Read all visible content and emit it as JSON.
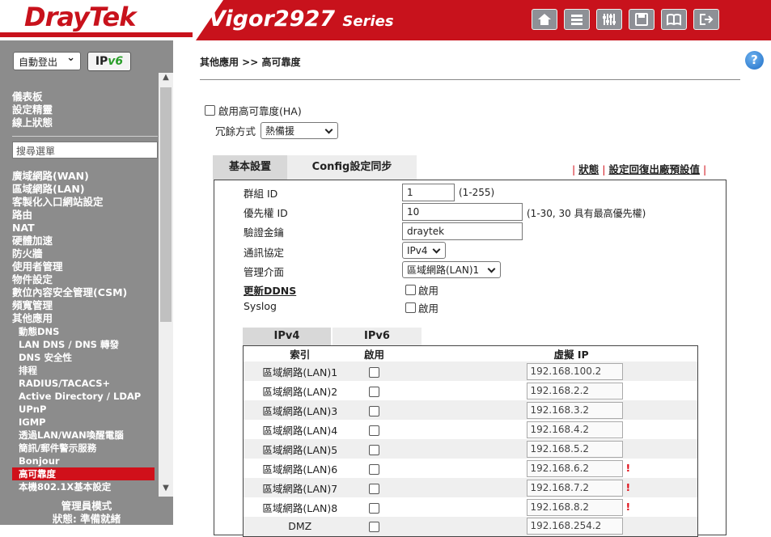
{
  "header": {
    "brand": "DrayTek",
    "model": "Vigor2927",
    "model_suffix": "Series",
    "icons": [
      "home-icon",
      "menu-icon",
      "settings-sliders-icon",
      "save-icon",
      "manual-book-icon",
      "logout-icon"
    ]
  },
  "sidebar": {
    "auto_logout": "自動登出",
    "ipv6_label_a": "IP",
    "ipv6_label_b": "v6",
    "group1": [
      "儀表板",
      "設定精靈",
      "線上狀態"
    ],
    "search_placeholder": "搜尋選單",
    "group2": [
      "廣域網路(WAN)",
      "區域網路(LAN)",
      "客製化入口網站設定",
      "路由",
      "NAT",
      "硬體加速",
      "防火牆",
      "使用者管理",
      "物件設定",
      "數位內容安全管理(CSM)",
      "頻寬管理",
      "其他應用"
    ],
    "sub_items": [
      "動態DNS",
      "LAN DNS / DNS 轉發",
      "DNS 安全性",
      "排程",
      "RADIUS/TACACS+",
      "Active Directory / LDAP",
      "UPnP",
      "IGMP",
      "透過LAN/WAN喚醒電腦",
      "簡訊/郵件警示服務",
      "Bonjour",
      "高可靠度",
      "本機802.1X基本設定"
    ],
    "active_sub": "高可靠度",
    "footer_line1": "管理員模式",
    "footer_line2": "狀態: 準備就緒"
  },
  "main": {
    "breadcrumb": "其他應用 >> 高可靠度",
    "ha_enable_label": "啟用高可靠度(HA)",
    "redundancy_label": "冗餘方式",
    "redundancy_value": "熱備援",
    "tabs": [
      "基本設置",
      "Config設定同步"
    ],
    "links": {
      "status": "狀態",
      "restore": "設定回復出廠預設值"
    },
    "form": {
      "group_id_label": "群組 ID",
      "group_id_value": "1",
      "group_id_hint": "(1-255)",
      "priority_label": "優先權 ID",
      "priority_value": "10",
      "priority_hint": "(1-30, 30 具有最高優先權)",
      "auth_key_label": "驗證金鑰",
      "auth_key_value": "draytek",
      "protocol_label": "通訊協定",
      "protocol_value": "IPv4",
      "mgmt_label": "管理介面",
      "mgmt_value": "區域網路(LAN)1",
      "ddns_label": "更新DDNS",
      "ddns_enable": "啟用",
      "syslog_label": "Syslog",
      "syslog_enable": "啟用"
    },
    "ip_tabs": [
      "IPv4",
      "IPv6"
    ],
    "table": {
      "headers": [
        "索引",
        "啟用",
        "虛擬 IP"
      ],
      "rows": [
        {
          "index": "區域網路(LAN)1",
          "vip": "192.168.100.2",
          "warn": ""
        },
        {
          "index": "區域網路(LAN)2",
          "vip": "192.168.2.2",
          "warn": ""
        },
        {
          "index": "區域網路(LAN)3",
          "vip": "192.168.3.2",
          "warn": ""
        },
        {
          "index": "區域網路(LAN)4",
          "vip": "192.168.4.2",
          "warn": ""
        },
        {
          "index": "區域網路(LAN)5",
          "vip": "192.168.5.2",
          "warn": ""
        },
        {
          "index": "區域網路(LAN)6",
          "vip": "192.168.6.2",
          "warn": "!"
        },
        {
          "index": "區域網路(LAN)7",
          "vip": "192.168.7.2",
          "warn": "!"
        },
        {
          "index": "區域網路(LAN)8",
          "vip": "192.168.8.2",
          "warn": "!"
        },
        {
          "index": "DMZ",
          "vip": "192.168.254.2",
          "warn": ""
        }
      ]
    }
  },
  "colors": {
    "brand_red": "#c8121c",
    "sidebar_gray": "#8c8c8c",
    "active_red": "#d0101a"
  }
}
